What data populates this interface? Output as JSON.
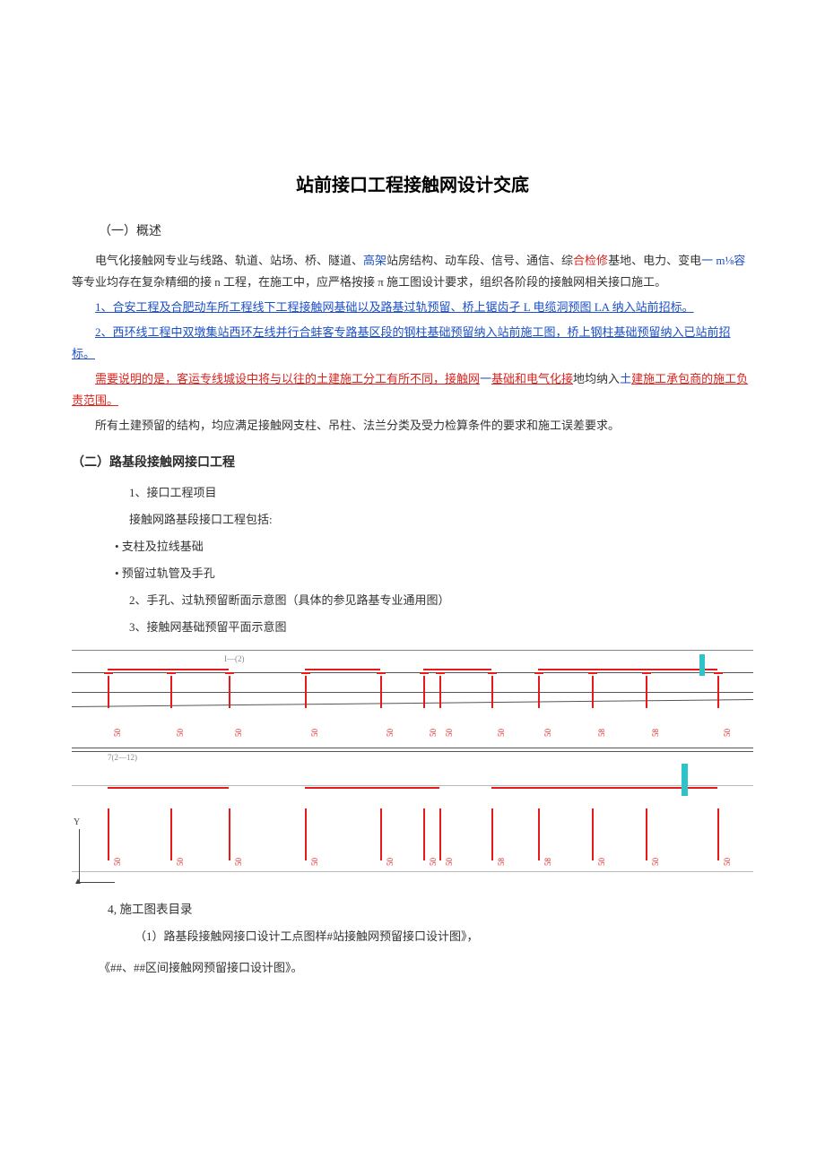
{
  "title": "站前接口工程接触网设计交底",
  "sec1": {
    "header": "（一）概述",
    "p1_lead": "电气化接触网专业与线路、轨道、站场、桥、隧道、",
    "p1_blue1": "高架",
    "p1_mid1": "站房结构、动车段、信号、通信、综",
    "p1_red1": "合检修",
    "p1_mid2": "基地、电力、变电",
    "p1_blue2": "一 m⅛容",
    "p1_mid3": "等专业均存在复杂精细的接 n 工程，在施工中，应严格按接 π 施工图设计要求，组织各阶段的接触网相关接口施工。",
    "p2_blue": "1、合安工程及合肥动车所工程线下工程接触网基础以及路基过轨预留、桥上锯齿孑 L 电缆洞预图 LA 纳入站前招标。",
    "p3_blue": "2、西环线工程中双墩集站西环左线并行合蚌客专路基区段的钢柱基础预留纳入站前施工图，桥上钢柱基础预留纳入已站前招标。",
    "p4_red_lead": "需要说明的是，客运专线城设中将与以往的土建施工分工有所不同，接触网",
    "p4_blue": "一",
    "p4_red_mid": "基础和电气化接",
    "p4_mid": "地均纳入",
    "p4_blue2": "土",
    "p4_red_tail": "建施工承包商的施工负责范围。",
    "p5": "所有土建预留的结构，均应满足接触网支柱、吊柱、法兰分类及受力检算条件的要求和施工误差要求。"
  },
  "sec2": {
    "header": "（二）路基段接触网接口工程",
    "item1": "1、接口工程项目",
    "item1_sub": "接触网路基段接口工程包括:",
    "bullet1": "• 支柱及拉线基础",
    "bullet2": "• 预留过轨管及手孔",
    "item2": "2、手孔、过轨预留断面示意图（具体的参见路基专业通用图）",
    "item3": "3、接触网基础预留平面示意图",
    "item4": "4, 施工图表目录",
    "item4_sub1": "（1）路基段接触网接口设计工点图样#站接触网预留接口设计图》，",
    "item4_sub2": "《##、##区间接触网预留接口设计图》。"
  },
  "diagram": {
    "upper_label": "I—(2)",
    "mid_label": "7(2—12)",
    "axis_y": "Y",
    "vals": [
      "50",
      "50",
      "50",
      "50",
      "50",
      "50",
      "50",
      "50",
      "50",
      "58",
      "58",
      "50",
      "50"
    ]
  }
}
